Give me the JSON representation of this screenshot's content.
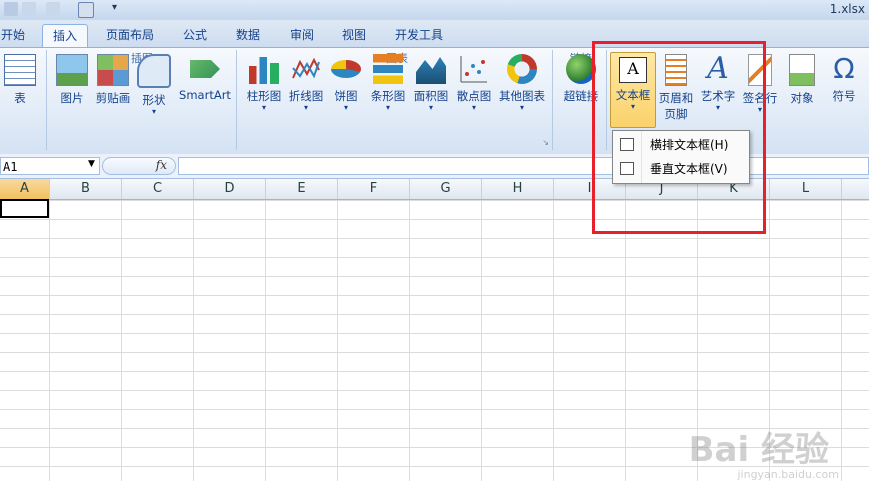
{
  "titlebar": {
    "filename": "1.xlsx"
  },
  "tabs": [
    "开始",
    "插入",
    "页面布局",
    "公式",
    "数据",
    "审阅",
    "视图",
    "开发工具"
  ],
  "active_tab": "插入",
  "ribbon": {
    "groups": [
      {
        "label": "",
        "buttons": [
          "表"
        ]
      },
      {
        "label": "插图",
        "buttons": [
          "图片",
          "剪贴画",
          "形状",
          "SmartArt"
        ]
      },
      {
        "label": "图表",
        "buttons": [
          "柱形图",
          "折线图",
          "饼图",
          "条形图",
          "面积图",
          "散点图",
          "其他图表"
        ]
      },
      {
        "label": "链接",
        "buttons": [
          "超链接"
        ]
      },
      {
        "label": "",
        "buttons": [
          "文本框",
          "页眉和\n页脚",
          "艺术字",
          "签名行",
          "对象",
          "符号"
        ]
      }
    ],
    "btn_table": "表",
    "btn_picture": "图片",
    "btn_clipart": "剪贴画",
    "btn_shapes": "形状",
    "btn_smartart": "SmartArt",
    "btn_column": "柱形图",
    "btn_line": "折线图",
    "btn_pie": "饼图",
    "btn_bar": "条形图",
    "btn_area": "面积图",
    "btn_scatter": "散点图",
    "btn_other": "其他图表",
    "btn_hyperlink": "超链接",
    "btn_textbox": "文本框",
    "btn_headerfooter_1": "页眉和",
    "btn_headerfooter_2": "页脚",
    "btn_wordart": "艺术字",
    "btn_signature": "签名行",
    "btn_object": "对象",
    "btn_symbol": "符号",
    "label_illus": "插图",
    "label_charts": "图表",
    "label_links": "链接"
  },
  "formula_bar": {
    "name_box": "A1",
    "fx": "fx",
    "value": ""
  },
  "columns": [
    "A",
    "B",
    "C",
    "D",
    "E",
    "F",
    "G",
    "H",
    "I",
    "J",
    "K",
    "L"
  ],
  "dropdown": {
    "items": [
      "横排文本框(H)",
      "垂直文本框(V)"
    ]
  },
  "watermark": {
    "main": "Bai 经验",
    "sub": "jingyan.baidu.com"
  }
}
